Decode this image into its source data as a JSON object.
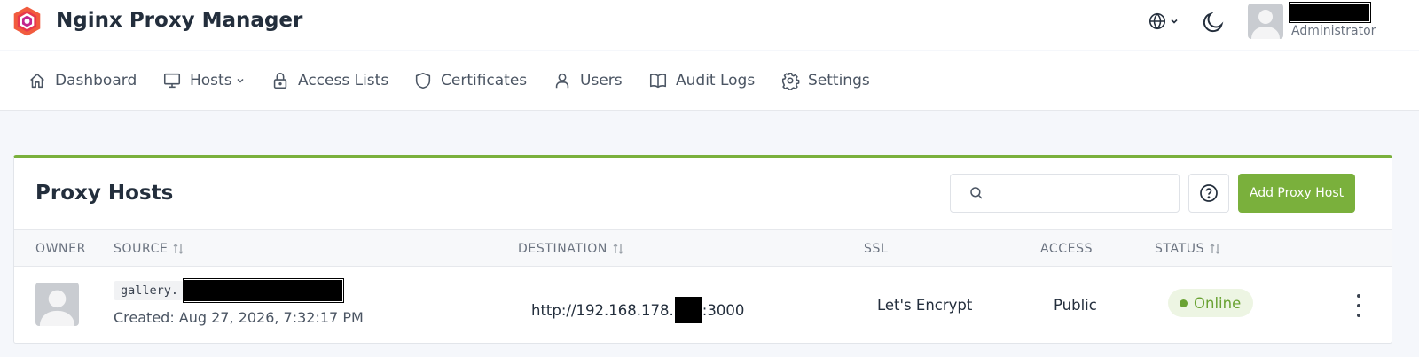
{
  "header": {
    "brand": "Nginx Proxy Manager",
    "user_role": "Administrator",
    "icons": [
      "logo-icon",
      "globe-icon",
      "chevron-down-icon",
      "moon-icon",
      "avatar"
    ]
  },
  "nav": {
    "items": [
      {
        "label": "Dashboard",
        "icon": "home-icon"
      },
      {
        "label": "Hosts",
        "icon": "monitor-icon"
      },
      {
        "label": "Access Lists",
        "icon": "lock-icon"
      },
      {
        "label": "Certificates",
        "icon": "shield-icon"
      },
      {
        "label": "Users",
        "icon": "user-icon"
      },
      {
        "label": "Audit Logs",
        "icon": "book-icon"
      },
      {
        "label": "Settings",
        "icon": "gear-icon"
      }
    ]
  },
  "card": {
    "title": "Proxy Hosts",
    "search_placeholder": "",
    "add_button": "Add Proxy Host",
    "columns": {
      "owner": "OWNER",
      "source": "SOURCE",
      "destination": "DESTINATION",
      "ssl": "SSL",
      "access": "ACCESS",
      "status": "STATUS"
    },
    "rows": [
      {
        "source_prefix": "gallery.",
        "created": "Created: Aug 27, 2026, 7:32:17 PM",
        "destination_prefix": "http://192.168.178.",
        "destination_suffix": ":3000",
        "ssl": "Let's Encrypt",
        "access": "Public",
        "status": "Online"
      }
    ]
  },
  "colors": {
    "accent": "#7ab03c",
    "status_online": "#6aa233",
    "status_bg": "#edf5e3",
    "page_bg": "#f5f7fb"
  }
}
